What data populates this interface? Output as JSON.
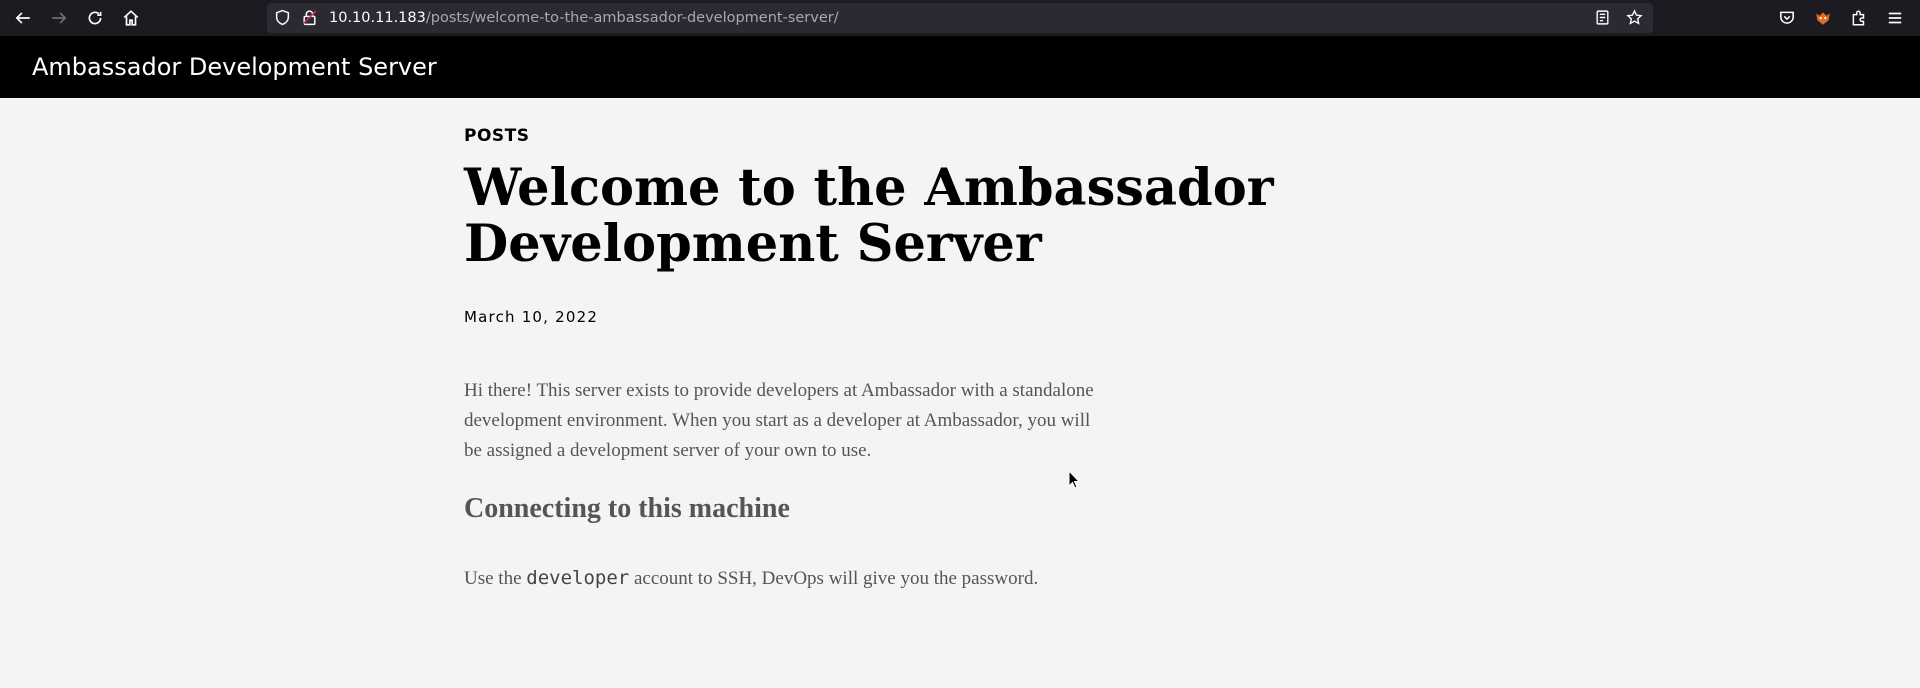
{
  "browser": {
    "url_host": "10.10.11.183",
    "url_path": "/posts/welcome-to-the-ambassador-development-server/",
    "icons": {
      "back": "back-arrow-icon",
      "forward": "forward-arrow-icon",
      "reload": "reload-icon",
      "home": "home-icon",
      "shield": "tracking-shield-icon",
      "lock": "insecure-lock-icon",
      "reader": "reader-view-icon",
      "bookmark": "bookmark-star-icon",
      "pocket": "pocket-icon",
      "extension_fox": "fox-extension-icon",
      "extensions": "puzzle-extensions-icon",
      "menu": "hamburger-menu-icon"
    }
  },
  "site": {
    "title": "Ambassador Development Server"
  },
  "post": {
    "section": "POSTS",
    "title": "Welcome to the Ambassador Development Server",
    "date": "March 10, 2022",
    "paragraph1": "Hi there! This server exists to provide developers at Ambassador with a standalone development environment. When you start as a developer at Ambassador, you will be assigned a development server of your own to use.",
    "subheading": "Connecting to this machine",
    "paragraph2_before": "Use the ",
    "paragraph2_code": "developer",
    "paragraph2_after": " account to SSH, DevOps will give you the password."
  },
  "colors": {
    "browser_bg": "#1c1b22",
    "urlbar_bg": "#2b2a33",
    "header_bg": "#000000",
    "page_bg": "#f4f4f4",
    "body_text": "#555555"
  }
}
